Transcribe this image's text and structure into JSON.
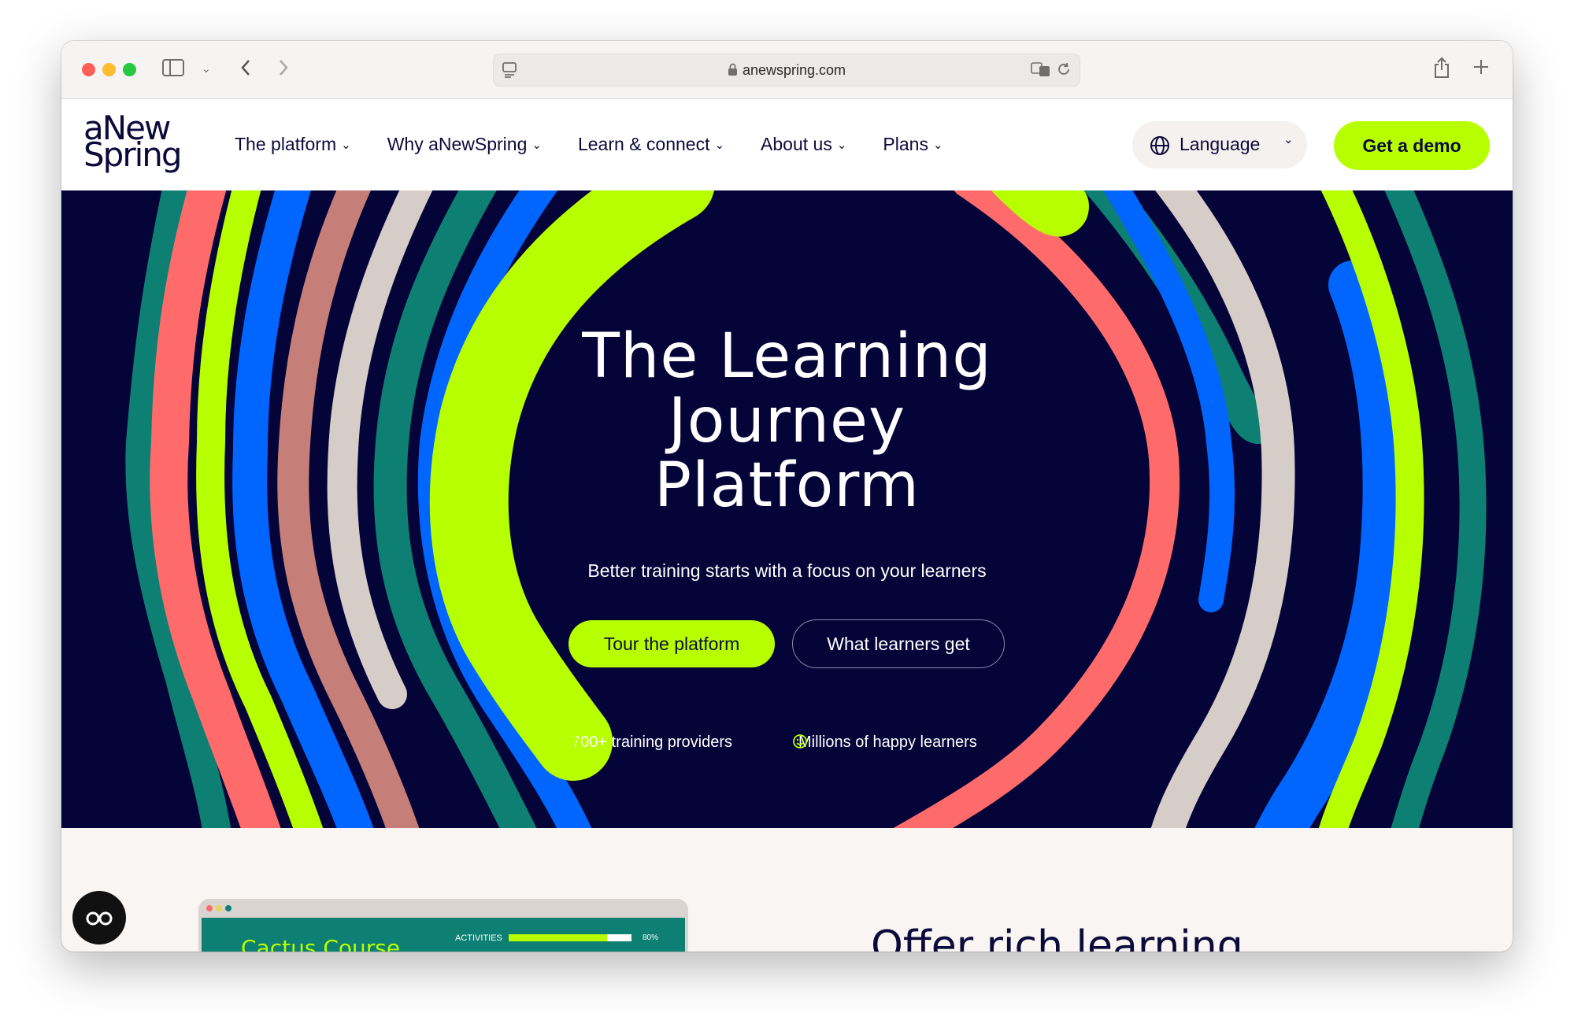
{
  "browser": {
    "url": "anewspring.com",
    "icons": [
      "sidebar-icon",
      "chevron-down-icon",
      "back-icon",
      "forward-icon",
      "reader-icon",
      "lock-icon",
      "translate-icon",
      "reload-icon",
      "share-icon",
      "new-tab-icon",
      "tabs-overview-icon"
    ]
  },
  "nav": {
    "logo_line1": "aNew",
    "logo_line2": "Spring",
    "items": [
      {
        "label": "The platform"
      },
      {
        "label": "Why aNewSpring"
      },
      {
        "label": "Learn & connect"
      },
      {
        "label": "About us"
      },
      {
        "label": "Plans"
      }
    ],
    "language_label": "Language",
    "demo_label": "Get a demo"
  },
  "hero": {
    "title_line1": "The Learning",
    "title_line2": "Journey",
    "title_line3": "Platform",
    "subtitle": "Better training starts with a focus on your learners",
    "primary_button": "Tour the platform",
    "secondary_button": "What learners get",
    "stat1": "700+ training providers",
    "stat2": "Millions of happy learners"
  },
  "preview": {
    "course_title": "Cactus Course",
    "row_label": "ACTIVITIES",
    "row_value": "80%",
    "row_fraction": 0.8
  },
  "section_heading": "Offer rich learning",
  "colors": {
    "navy": "#050438",
    "lime": "#b7ff00",
    "coral": "#ff6b6b",
    "blue": "#0066ff",
    "teal": "#0d7f73"
  }
}
